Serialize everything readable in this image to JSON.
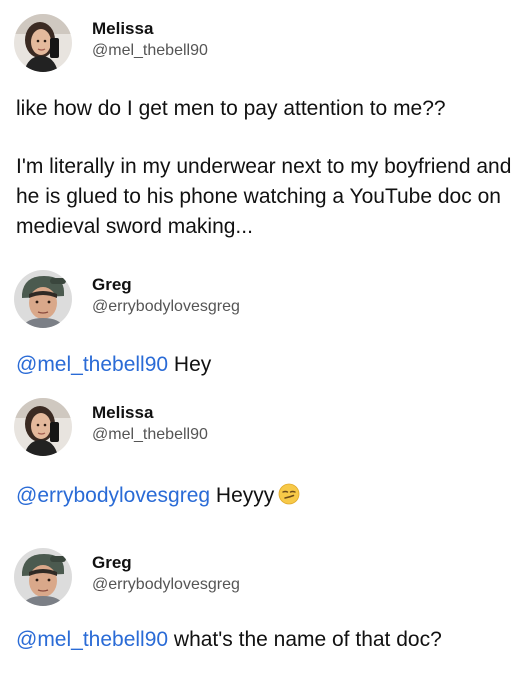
{
  "tweets": [
    {
      "display_name": "Melissa",
      "handle": "@mel_thebell90",
      "avatar_icon": "woman-selfie-avatar",
      "paragraphs": [
        "like how do I get men to pay attention to me??",
        "I'm literally in my underwear next to my boyfriend and he is glued to his phone watching a YouTube doc on medieval sword making..."
      ]
    },
    {
      "display_name": "Greg",
      "handle": "@errybodylovesgreg",
      "avatar_icon": "man-backwards-cap-avatar",
      "mention": "@mel_thebell90",
      "text": " Hey"
    },
    {
      "display_name": "Melissa",
      "handle": "@mel_thebell90",
      "avatar_icon": "woman-selfie-avatar",
      "mention": "@errybodylovesgreg",
      "text": " Heyyy",
      "emoji": "smirking-face-emoji"
    },
    {
      "display_name": "Greg",
      "handle": "@errybodylovesgreg",
      "avatar_icon": "man-backwards-cap-avatar",
      "mention": "@mel_thebell90",
      "text": " what's the name of that doc?"
    }
  ],
  "colors": {
    "mention": "#2a6bd6",
    "text": "#111111",
    "handle": "#555555",
    "background": "#ffffff"
  }
}
